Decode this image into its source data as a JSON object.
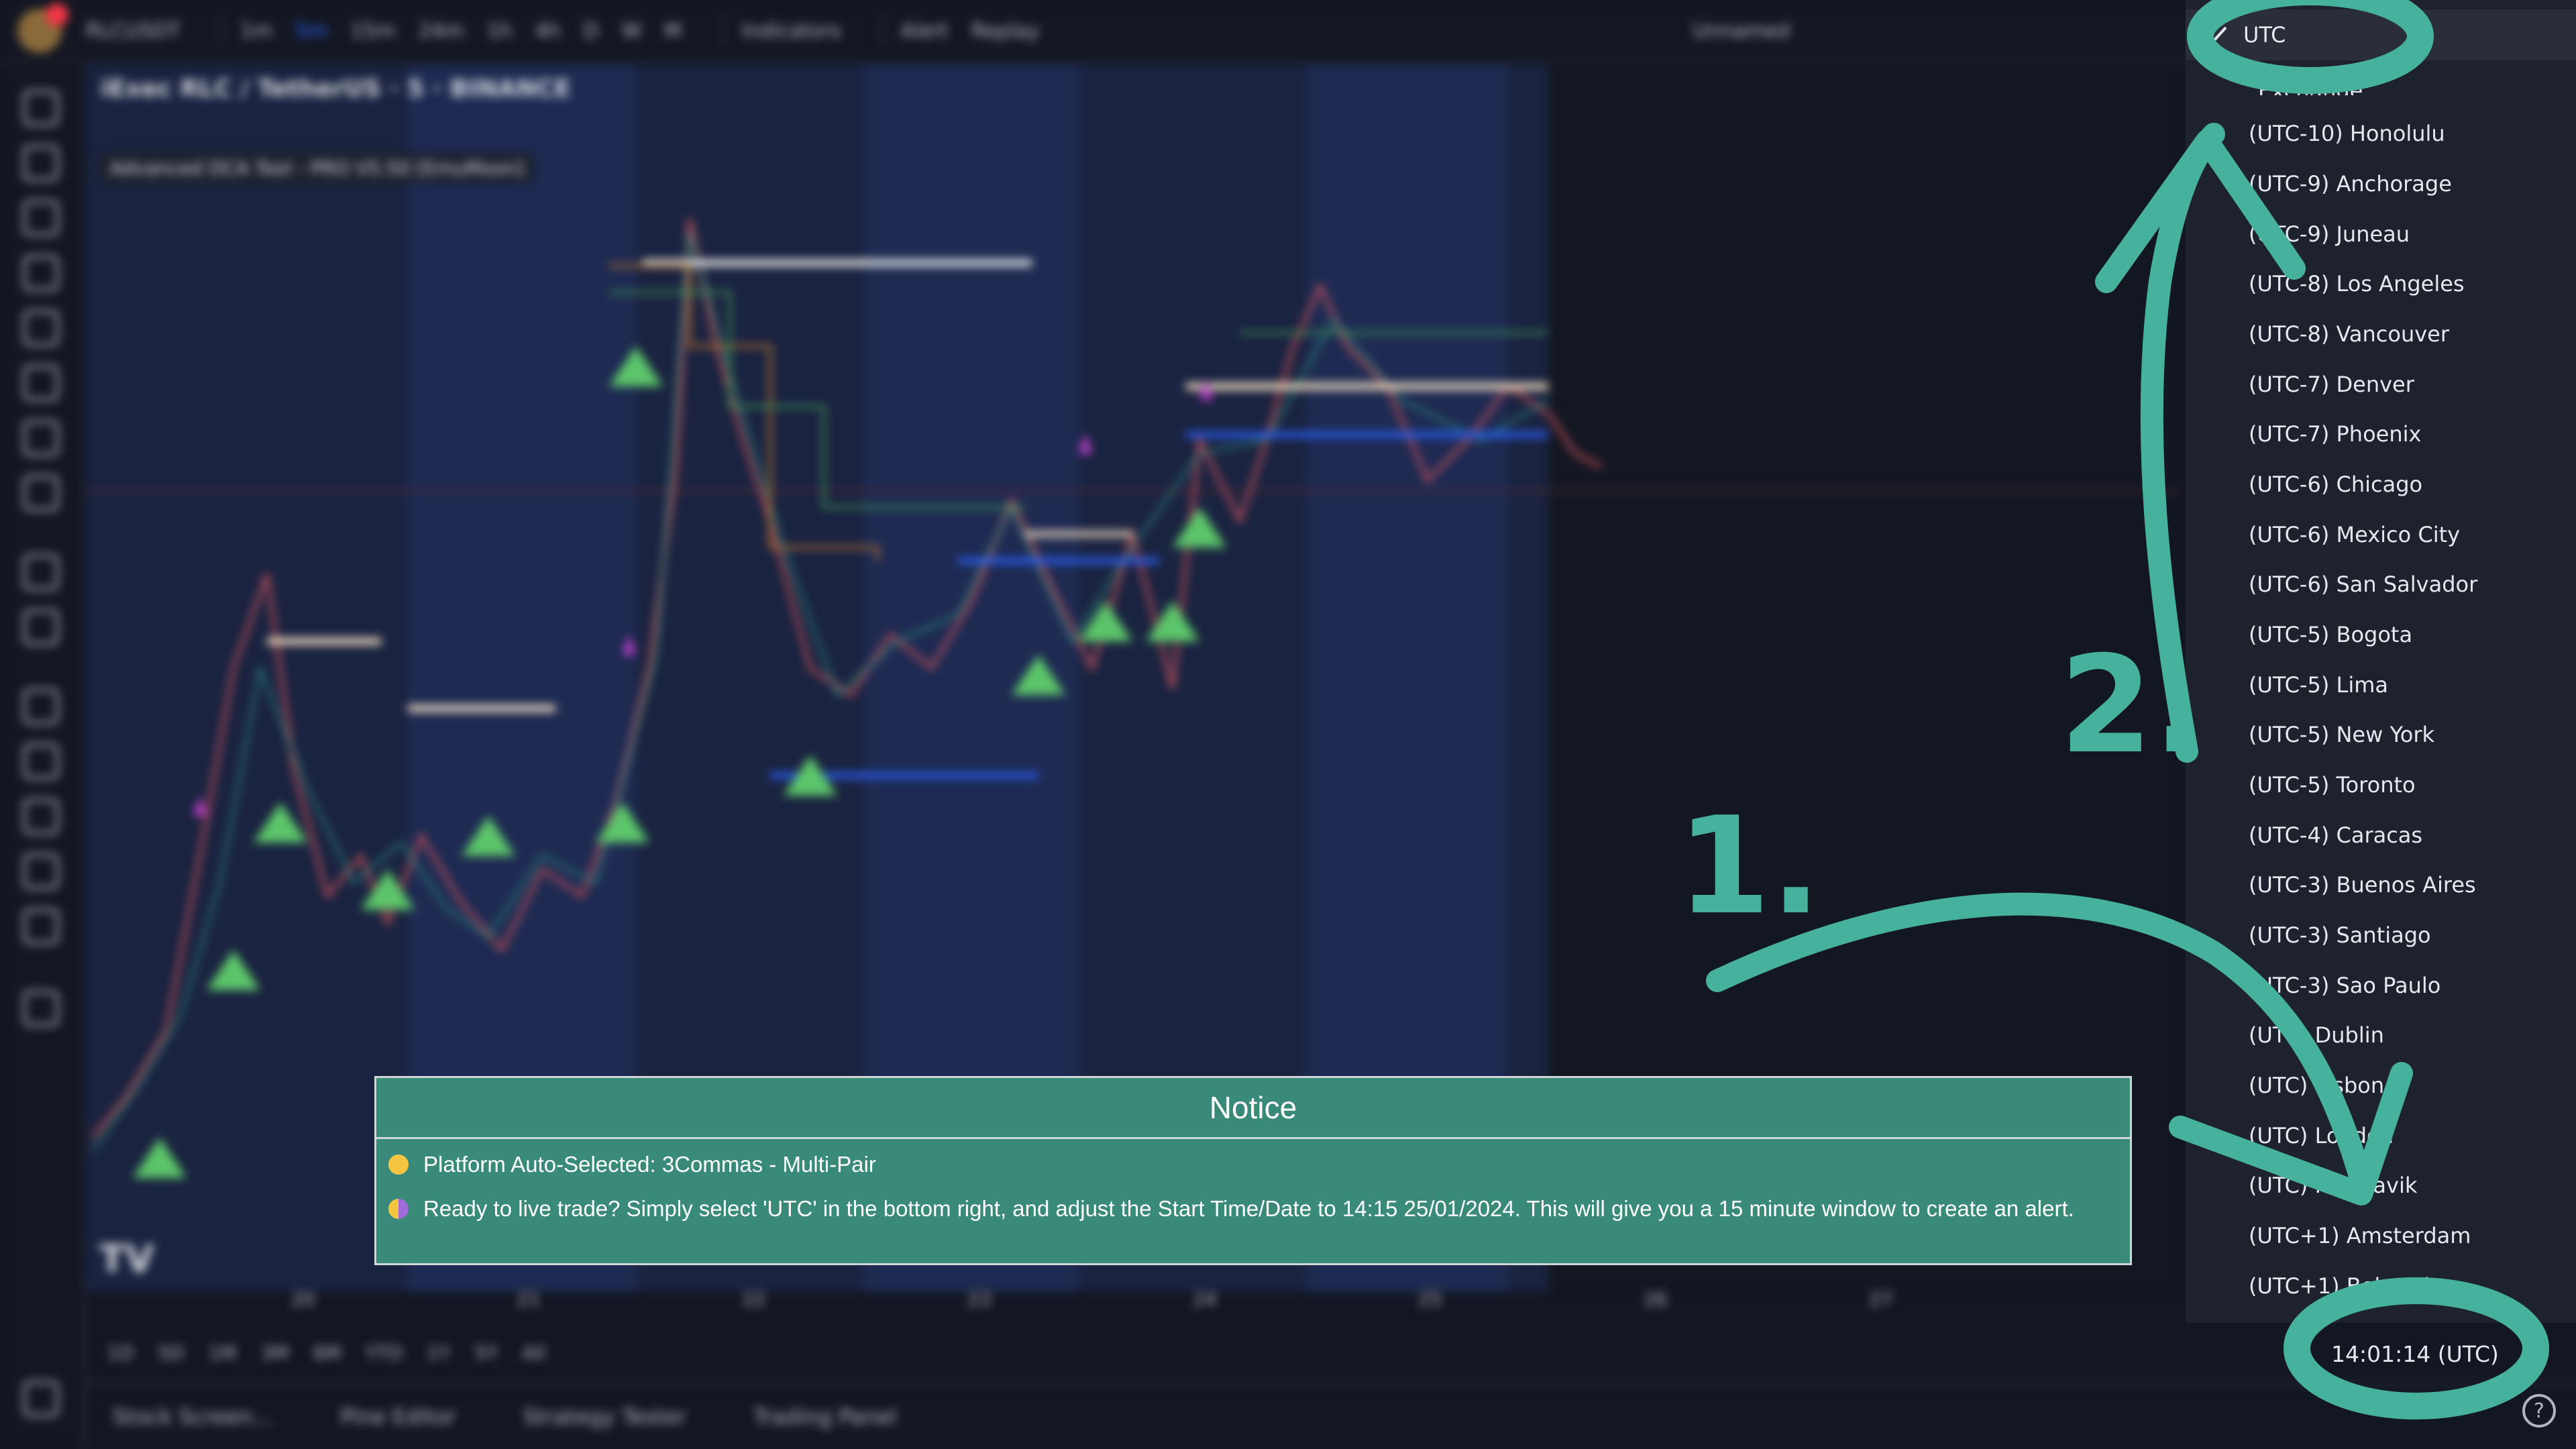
{
  "toolbar": {
    "symbol": "RLCUSDT",
    "intervals": [
      "1m",
      "5m",
      "15m",
      "24m",
      "1h",
      "4h",
      "D",
      "W",
      "M"
    ],
    "active_interval": "5m",
    "indicators_label": "Indicators",
    "alert_label": "Alert",
    "replay_label": "Replay",
    "unnamed_label": "Unnamed"
  },
  "chart": {
    "symbol_title": "iExec RLC / TetherUS · 5 · BINANCE",
    "indicator_label": "Advanced DCA Tool - PRO V5.50 [EmuMoon]",
    "date_labels": [
      "20",
      "21",
      "22",
      "23",
      "24",
      "25",
      "26",
      "27"
    ],
    "range_buttons": [
      "1D",
      "5D",
      "1M",
      "3M",
      "6M",
      "YTD",
      "1Y",
      "5Y",
      "All"
    ]
  },
  "bottom_tabs": [
    "Stock Screen...",
    "Pine Editor",
    "Strategy Tester",
    "Trading Panel"
  ],
  "timezone_menu": {
    "selected": "UTC",
    "partial_item": "Exchange",
    "items": [
      "(UTC-10) Honolulu",
      "(UTC-9) Anchorage",
      "(UTC-9) Juneau",
      "(UTC-8) Los Angeles",
      "(UTC-8) Vancouver",
      "(UTC-7) Denver",
      "(UTC-7) Phoenix",
      "(UTC-6) Chicago",
      "(UTC-6) Mexico City",
      "(UTC-6) San Salvador",
      "(UTC-5) Bogota",
      "(UTC-5) Lima",
      "(UTC-5) New York",
      "(UTC-5) Toronto",
      "(UTC-4) Caracas",
      "(UTC-3) Buenos Aires",
      "(UTC-3) Santiago",
      "(UTC-3) Sao Paulo",
      "(UTC) Dublin",
      "(UTC) Lisbon",
      "(UTC) London",
      "(UTC) Reykjavik",
      "(UTC+1) Amsterdam",
      "(UTC+1) Belgrade"
    ]
  },
  "clock": "14:01:14 (UTC)",
  "notice": {
    "title": "Notice",
    "line1": "Platform Auto-Selected: 3Commas - Multi-Pair",
    "line2": "Ready to live trade? Simply select 'UTC' in the bottom right, and adjust the Start Time/Date to 14:15  25/01/2024. This will give you a 15 minute window to create an alert.",
    "line1_dot_color": "#f5c542",
    "line2_dot_color": "#a06ad8"
  },
  "annotations": {
    "step1": "1.",
    "step2": "2.",
    "color": "#46b29d"
  },
  "colors": {
    "background": "#131722",
    "menu_bg": "#1e222d",
    "notice_bg": "#3a8a7a",
    "accent": "#2962ff"
  }
}
